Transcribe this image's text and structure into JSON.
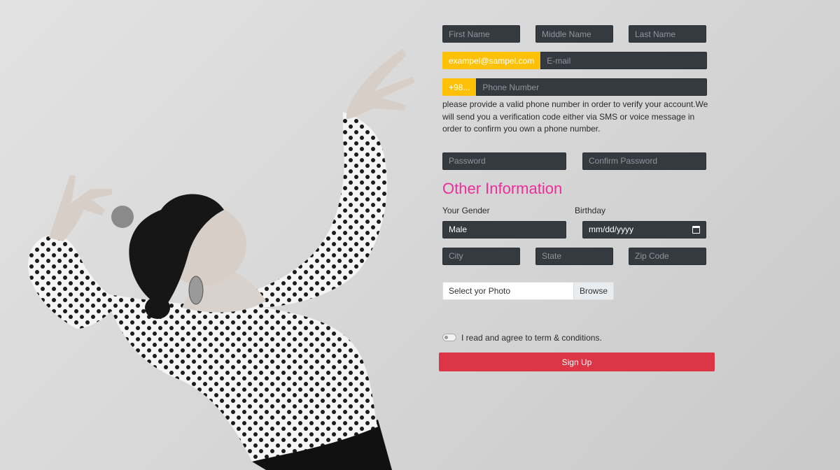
{
  "form": {
    "first_name_placeholder": "First Name",
    "middle_name_placeholder": "Middle Name",
    "last_name_placeholder": "Last Name",
    "email_prefix": "exampel@sampel.com",
    "email_placeholder": "E-mail",
    "phone_prefix": "+98...",
    "phone_placeholder": "Phone Number",
    "phone_help": "please provide a valid phone number in order to verify your account.We will send you a verification code either via SMS or voice message in order to confirm you own a phone number.",
    "password_placeholder": "Password",
    "confirm_password_placeholder": "Confirm Password",
    "section_heading": "Other Information",
    "gender_label": "Your Gender",
    "gender_value": "Male",
    "birthday_label": "Birthday",
    "birthday_value": "mm/dd/yyyy",
    "city_placeholder": "City",
    "state_placeholder": "State",
    "zip_placeholder": "Zip Code",
    "photo_label": "Select yor Photo",
    "browse_label": "Browse",
    "terms_label": "I read and agree to term & conditions.",
    "signup_label": "Sign Up"
  },
  "colors": {
    "accent_heading": "#ee2d9a",
    "addon": "#ffc107",
    "input_bg": "#343a40",
    "signup": "#dc3545"
  },
  "icons": [
    "calendar-icon",
    "toggle-switch"
  ]
}
